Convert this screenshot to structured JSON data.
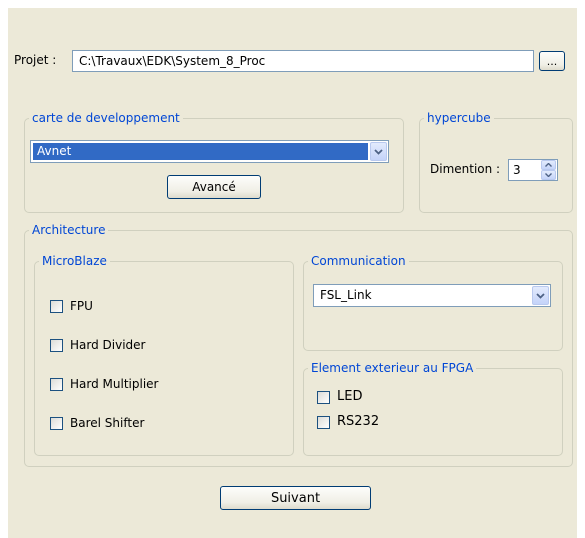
{
  "project": {
    "label": "Projet :",
    "path": "C:\\Travaux\\EDK\\System_8_Proc",
    "browse_label": "..."
  },
  "board_group": {
    "title": "carte de developpement",
    "selected": "Avnet",
    "advanced_label": "Avancé"
  },
  "hypercube_group": {
    "title": "hypercube",
    "dimension_label": "Dimention :",
    "dimension_value": "3"
  },
  "architecture": {
    "title": "Architecture",
    "microblaze": {
      "title": "MicroBlaze",
      "options": [
        {
          "label": "FPU",
          "checked": false
        },
        {
          "label": "Hard Divider",
          "checked": false
        },
        {
          "label": "Hard Multiplier",
          "checked": false
        },
        {
          "label": "Barel Shifter",
          "checked": false
        }
      ]
    },
    "communication": {
      "title": "Communication",
      "selected": "FSL_Link"
    },
    "external": {
      "title": "Element exterieur au FPGA",
      "options": [
        {
          "label": "LED",
          "checked": false
        },
        {
          "label": "RS232",
          "checked": false
        }
      ]
    }
  },
  "next_label": "Suivant",
  "colors": {
    "panel": "#ece9d8",
    "legend": "#0046d5",
    "selection": "#316ac5"
  }
}
